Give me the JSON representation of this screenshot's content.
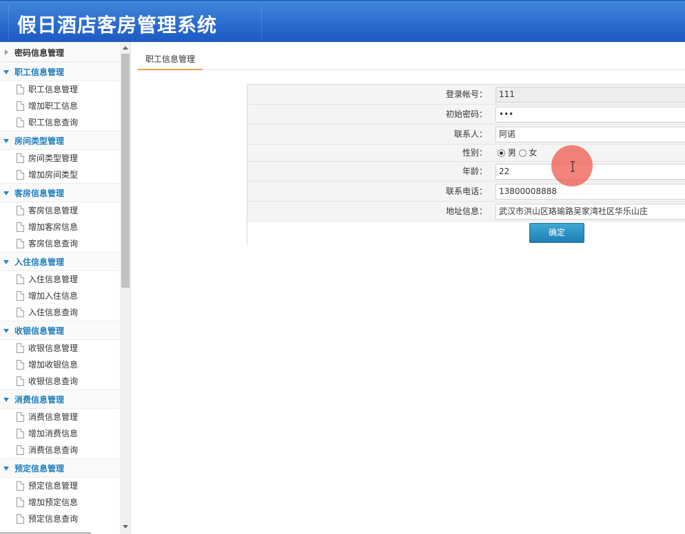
{
  "app": {
    "title": "假日酒店客房管理系统"
  },
  "sidebar": {
    "groups": [
      {
        "title": "密码信息管理",
        "collapsed": true,
        "items": []
      },
      {
        "title": "职工信息管理",
        "collapsed": false,
        "items": [
          "职工信息管理",
          "增加职工信息",
          "职工信息查询"
        ]
      },
      {
        "title": "房间类型管理",
        "collapsed": false,
        "items": [
          "房间类型管理",
          "增加房间类型"
        ]
      },
      {
        "title": "客房信息管理",
        "collapsed": false,
        "items": [
          "客房信息管理",
          "增加客房信息",
          "客房信息查询"
        ]
      },
      {
        "title": "入住信息管理",
        "collapsed": false,
        "items": [
          "入住信息管理",
          "增加入住信息",
          "入住信息查询"
        ]
      },
      {
        "title": "收银信息管理",
        "collapsed": false,
        "items": [
          "收银信息管理",
          "增加收银信息",
          "收银信息查询"
        ]
      },
      {
        "title": "消费信息管理",
        "collapsed": false,
        "items": [
          "消费信息管理",
          "增加消费信息",
          "消费信息查询"
        ]
      },
      {
        "title": "预定信息管理",
        "collapsed": false,
        "items": [
          "预定信息管理",
          "增加预定信息",
          "预定信息查询"
        ]
      }
    ]
  },
  "main": {
    "tab": "职工信息管理",
    "form": {
      "account_label": "登录帐号：",
      "account_value": "111",
      "password_label": "初始密码：",
      "password_value": "•••",
      "contact_label": "联系人：",
      "contact_value": "阿诺",
      "gender_label": "性别：",
      "gender_options": [
        "男",
        "女"
      ],
      "gender_selected": "男",
      "age_label": "年龄：",
      "age_value": "22",
      "phone_label": "联系电话：",
      "phone_value": "13800008888",
      "address_label": "地址信息：",
      "address_value": "武汉市洪山区珞瑜路吴家湾社区华乐山庄",
      "submit_label": "确定"
    }
  },
  "colors": {
    "header": "#2a6fd0",
    "accent": "#1e7fbe",
    "tab_underline": "#f0a050",
    "button": "#2b8fc4"
  }
}
